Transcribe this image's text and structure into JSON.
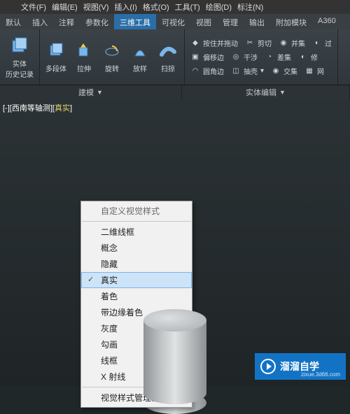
{
  "menubar": [
    "文件(F)",
    "编辑(E)",
    "视图(V)",
    "插入(I)",
    "格式(O)",
    "工具(T)",
    "绘图(D)",
    "标注(N)"
  ],
  "tabs": [
    "默认",
    "插入",
    "注释",
    "参数化",
    "三维工具",
    "可视化",
    "视图",
    "管理",
    "输出",
    "附加模块",
    "A360"
  ],
  "tabs_active_index": 4,
  "ribbon": {
    "big": [
      {
        "label": "实体\n历史记录"
      },
      {
        "label": "多段体"
      },
      {
        "label": "拉伸"
      },
      {
        "label": "旋转"
      },
      {
        "label": "放样"
      },
      {
        "label": "扫掠"
      }
    ],
    "right": [
      {
        "label": "按住并拖动",
        "row": 0
      },
      {
        "label": "剪切",
        "row": 0
      },
      {
        "label": "并集",
        "row": 0
      },
      {
        "label": "过",
        "row": 0
      },
      {
        "label": "偏移边",
        "row": 1
      },
      {
        "label": "干涉",
        "row": 1
      },
      {
        "label": "差集",
        "row": 1
      },
      {
        "label": "修",
        "row": 1
      },
      {
        "label": "圆角边",
        "row": 2
      },
      {
        "label": "抽壳",
        "row": 2
      },
      {
        "label": "交集",
        "row": 2
      },
      {
        "label": "网",
        "row": 2
      }
    ],
    "group_left": "建模",
    "group_right": "实体编辑"
  },
  "view": {
    "prefix_open": "[-][",
    "label1": "西南等轴测",
    "mid": "][",
    "label2": "真实",
    "suffix": "]"
  },
  "context_menu": {
    "header": "自定义视觉样式",
    "items": [
      "二维线框",
      "概念",
      "隐藏",
      "真实",
      "着色",
      "带边缘着色",
      "灰度",
      "勾画",
      "线框",
      "X 射线"
    ],
    "checked_index": 3,
    "footer": "视觉样式管理器..."
  },
  "brand": {
    "name": "溜溜自学",
    "url": "zixue.3d66.com"
  }
}
